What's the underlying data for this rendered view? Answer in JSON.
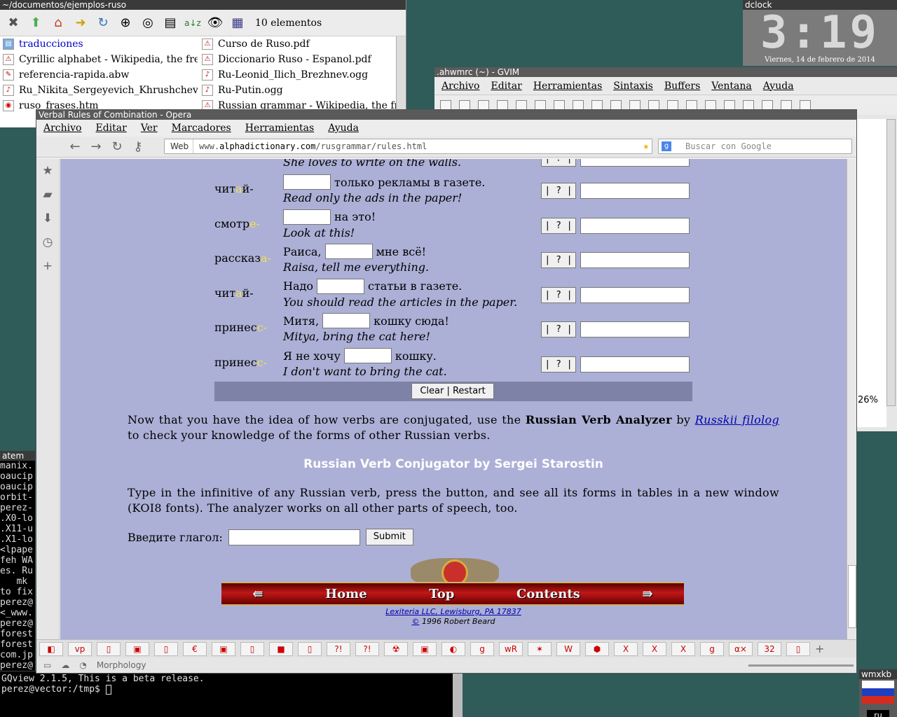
{
  "file_manager": {
    "title": "~/documentos/ejemplos-ruso",
    "count_label": "10 elementos",
    "col1": [
      {
        "name": "traducciones",
        "kind": "folder"
      },
      {
        "name": "Cyrillic alphabet - Wikipedia, the fre",
        "kind": "pdf"
      },
      {
        "name": "referencia-rapida.abw",
        "kind": "doc"
      },
      {
        "name": "Ru_Nikita_Sergeyevich_Khrushchev",
        "kind": "ogg"
      },
      {
        "name": "ruso_frases.htm",
        "kind": "htm"
      }
    ],
    "col2": [
      {
        "name": "Curso de Ruso.pdf",
        "kind": "pdf"
      },
      {
        "name": "Diccionario Ruso - Espanol.pdf",
        "kind": "pdf"
      },
      {
        "name": "Ru-Leonid_Ilich_Brezhnev.ogg",
        "kind": "ogg"
      },
      {
        "name": "Ru-Putin.ogg",
        "kind": "ogg"
      },
      {
        "name": "Russian grammar - Wikipedia, the fr",
        "kind": "pdf"
      }
    ]
  },
  "dclock": {
    "title": "dclock",
    "time": "3:19",
    "date": "Viernes, 14 de febrero de 2014"
  },
  "gvim": {
    "title": ".ahwmrc (~) - GVIM",
    "menu": [
      "Archivo",
      "Editar",
      "Herramientas",
      "Sintaxis",
      "Buffers",
      "Ventana",
      "Ayuda"
    ],
    "percent": "26%"
  },
  "atem": {
    "title": "atem",
    "lines": [
      "manix.",
      "oaucip",
      "oaucip",
      "orbit-",
      "perez-",
      ".X0-lo",
      ".X11-u",
      ".X1-lo",
      "<lpape",
      "feh WA",
      "es. Ru",
      "   mk",
      "to fix",
      "perez@",
      "<_www.",
      "perez@",
      "forest",
      "forest",
      "com.jp",
      "perez@"
    ]
  },
  "terminal": {
    "line1": "GQview 2.1.5, This is a beta release.",
    "prompt": "perez@vector:/tmp$ "
  },
  "wmxkb": {
    "title": "wmxkb",
    "lang": "ru"
  },
  "opera": {
    "title": "Verbal Rules of Combination - Opera",
    "menu": [
      "Archivo",
      "Editar",
      "Ver",
      "Marcadores",
      "Herramientas",
      "Ayuda"
    ],
    "address_prefix": "Web",
    "url_pre": "www.",
    "url_host": "alphadictionary.com",
    "url_path": "/rusgrammar/rules.html",
    "search_placeholder": "Buscar con Google",
    "status_text": "Morphology",
    "page": {
      "top_cut": "She loves to write on the walls.",
      "rows": [
        {
          "stem_a": "чит",
          "stem_hl": "а",
          "stem_b": "й-",
          "before": "",
          "after": "только рекламы в газете.",
          "en": "Read only the ads in the paper!"
        },
        {
          "stem_a": "смотр",
          "stem_hl": "е",
          "stem_b": "-",
          "before": "",
          "after": "на это!",
          "en": "Look at this!"
        },
        {
          "stem_a": "рассказ",
          "stem_hl": "а",
          "stem_b": "-",
          "before": "Раиса,",
          "after": "мне всё!",
          "en": "Raisa, tell me everything."
        },
        {
          "stem_a": "чит",
          "stem_hl": "а",
          "stem_b": "й-",
          "before": "Надо",
          "after": "статьи в газете.",
          "en": "You should read the articles in the paper."
        },
        {
          "stem_a": "принес",
          "stem_hl": "с",
          "stem_b": "-",
          "before": "Митя,",
          "after": "кошку сюда!",
          "en": "Mitya, bring the cat here!"
        },
        {
          "stem_a": "принес",
          "stem_hl": "с",
          "stem_b": "-",
          "before": "Я не хочу",
          "after": "кошку.",
          "en": "I don't want to bring the cat."
        }
      ],
      "check_label": "| ? |",
      "clear_label": "Clear | Restart",
      "para1_a": "Now that you have the idea of how verbs are conjugated, use the ",
      "para1_bold": "Russian Verb Analyzer",
      "para1_b": " by ",
      "para1_link": "Russkii filolog",
      "para1_c": " to check your knowledge of the forms of other Russian verbs.",
      "heading": "Russian Verb Conjugator by Sergei Starostin",
      "para2": "Type in the infinitive of any Russian verb, press the button, and see all its forms in tables in a new window (KOI8 fonts). The analyzer works on all other parts of speech, too.",
      "form_label": "Введите глагол:",
      "submit_label": "Submit",
      "nav_home": "Home",
      "nav_top": "Top",
      "nav_contents": "Contents",
      "credit_link": "Lexiteria LLC, Lewisburg, PA 17837",
      "copyright_sign": "©",
      "credit2": " 1996 Robert Beard"
    }
  }
}
